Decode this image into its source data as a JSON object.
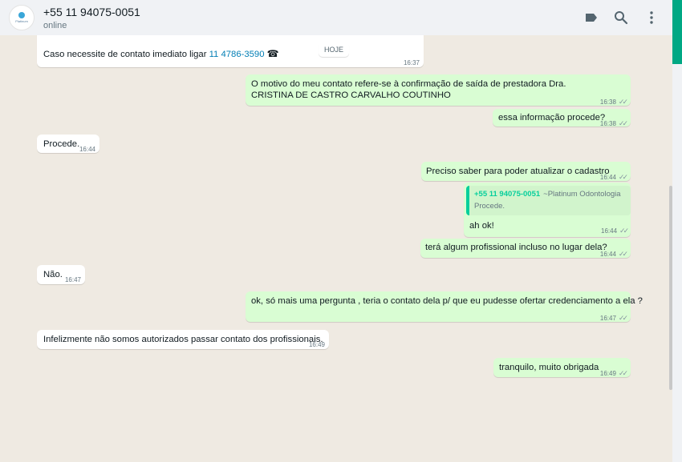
{
  "header": {
    "contact_name": "+55 11 94075-0051",
    "status": "online",
    "avatar_text": "Platinum",
    "icons": [
      "label-icon",
      "search-icon",
      "menu-icon"
    ]
  },
  "day_chip": "HOJE",
  "messages": {
    "m0": {
      "text_prefix": "Caso necessite de contato imediato ligar ",
      "phone": "11 4786-3590",
      "time": "16:37"
    },
    "m1": {
      "text": "O motivo do meu contato refere-se à confirmação de saída de prestadora Dra. CRISTINA DE CASTRO CARVALHO COUTINHO",
      "time": "16:38"
    },
    "m2": {
      "text": "essa informação procede?",
      "time": "16:38"
    },
    "m3": {
      "text": "Procede.",
      "time": "16:44"
    },
    "m4": {
      "text": "Preciso saber para poder atualizar o cadastro",
      "time": "16:44"
    },
    "m5": {
      "quote_author": "+55 11 94075-0051",
      "quote_pushname": "~Platinum Odontologia",
      "quote_text": "Procede.",
      "text": "ah ok!",
      "time": "16:44"
    },
    "m6": {
      "text": "terá algum profissional incluso no lugar dela?",
      "time": "16:44"
    },
    "m7": {
      "text": "Não.",
      "time": "16:47"
    },
    "m8": {
      "text": "ok, só mais uma pergunta , teria o contato dela p/ que eu pudesse ofertar credenciamento a ela ?",
      "time": "16:47"
    },
    "m9": {
      "text": "Infelizmente não somos autorizados passar contato dos profissionais.",
      "time": "16:49"
    },
    "m10": {
      "text": "tranquilo, muito obrigada",
      "time": "16:49"
    }
  },
  "colors": {
    "accent": "#00a884",
    "outgoing_bubble": "#d9fdd3",
    "incoming_bubble": "#ffffff",
    "chat_bg": "#efeae2",
    "link": "#027eb5"
  }
}
